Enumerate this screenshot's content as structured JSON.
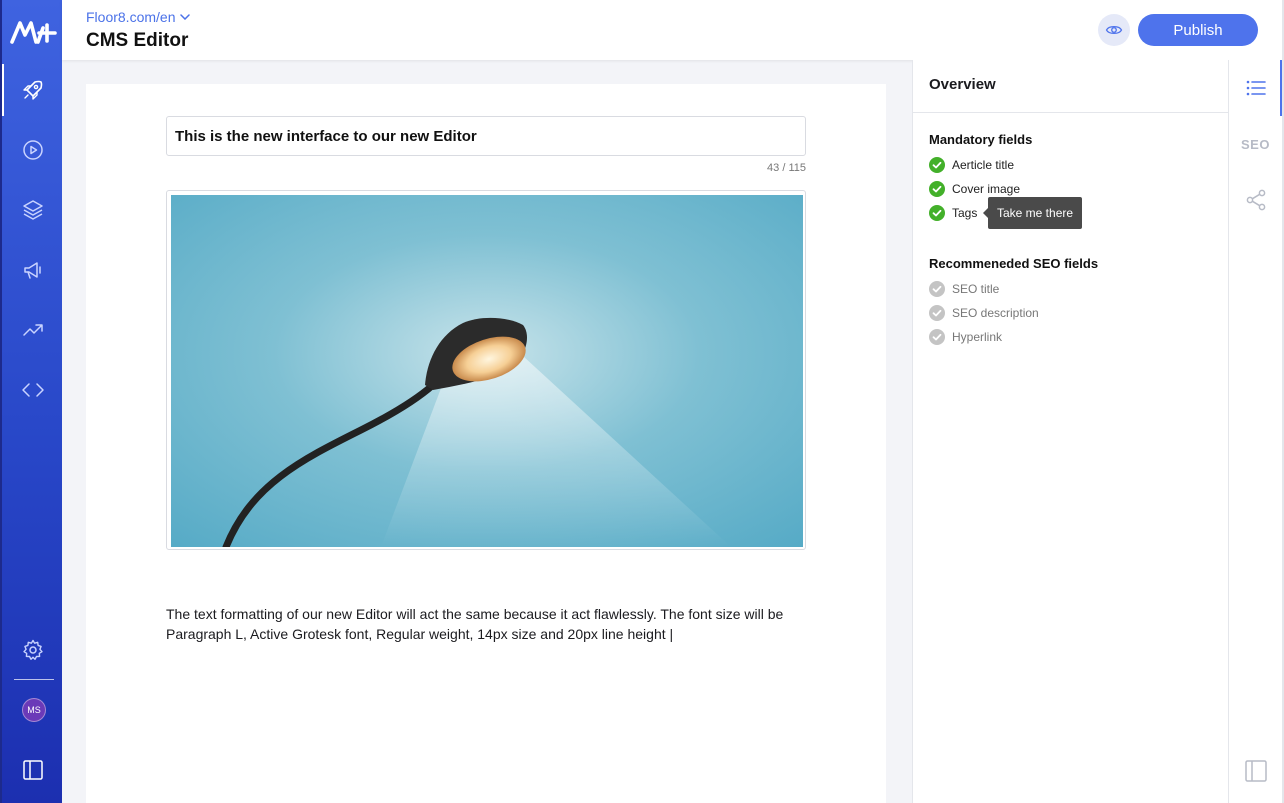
{
  "header": {
    "site_url": "Floor8.com/en",
    "title": "CMS Editor",
    "publish_label": "Publish"
  },
  "sidebar": {
    "items": [
      {
        "icon": "rocket-icon",
        "active": true
      },
      {
        "icon": "play-circle-icon"
      },
      {
        "icon": "layers-icon"
      },
      {
        "icon": "megaphone-icon"
      },
      {
        "icon": "trending-up-icon"
      },
      {
        "icon": "code-icon"
      }
    ],
    "settings_icon": "gear-icon",
    "avatar_initials": "MS",
    "toggle_icon": "sidebar-toggle-icon"
  },
  "editor": {
    "article_title": "This is the new interface to our new Editor",
    "char_count": "43 / 115",
    "body_text": "The text formatting of our new Editor will act the same because it act flawlessly. The font size will be Paragraph L, Active Grotesk font, Regular weight, 14px size and 20px line height |"
  },
  "overview": {
    "title": "Overview",
    "mandatory_title": "Mandatory fields",
    "mandatory": [
      {
        "label": "Aerticle title",
        "done": true
      },
      {
        "label": "Cover image",
        "done": true
      },
      {
        "label": "Tags",
        "done": true
      }
    ],
    "tooltip": "Take me there",
    "recommended_title": "Recommeneded SEO fields",
    "recommended": [
      {
        "label": "SEO title",
        "done": false
      },
      {
        "label": "SEO description",
        "done": false
      },
      {
        "label": "Hyperlink",
        "done": false
      }
    ]
  },
  "rail": {
    "seo_label": "SEO",
    "items": [
      "list-icon",
      "seo-icon",
      "share-icon",
      "panel-toggle-icon"
    ]
  },
  "colors": {
    "nav_gradient_top": "#3f63e0",
    "nav_gradient_bottom": "#1c2fb0",
    "accent": "#4e73ec",
    "success": "#43b02a",
    "pending": "#c4c4c4"
  }
}
